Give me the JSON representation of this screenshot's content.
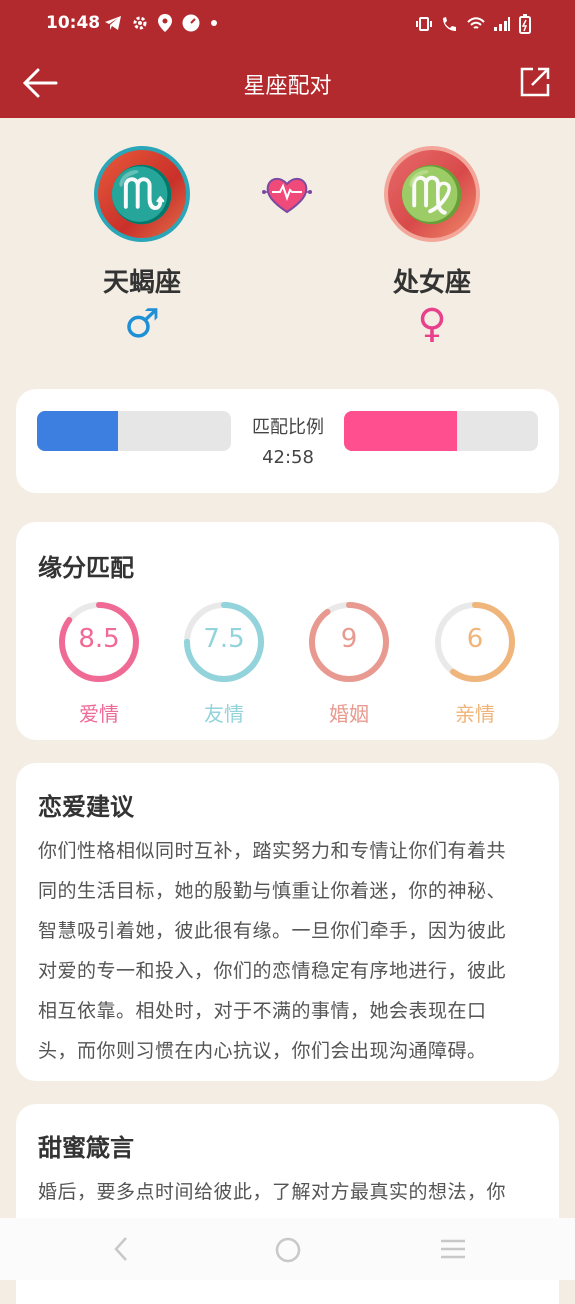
{
  "status_bar": {
    "time": "10:48"
  },
  "app_bar": {
    "title": "星座配对"
  },
  "pair": {
    "left": {
      "name": "天蝎座",
      "symbol": "♏",
      "gender_symbol": "♂",
      "gender_color": "#1f8fd6"
    },
    "right": {
      "name": "处女座",
      "symbol": "♍",
      "gender_symbol": "♀",
      "gender_color": "#e8408a"
    }
  },
  "ratio": {
    "label": "匹配比例",
    "value": "42:58",
    "male_share": 0.42,
    "female_share": 0.58,
    "male_color": "#3d7fe0",
    "female_color": "#ff4f8f"
  },
  "fate": {
    "title": "缘分匹配",
    "items": [
      {
        "value": "8.5",
        "score": 8.5,
        "label": "爱情",
        "color": "#f06a96"
      },
      {
        "value": "7.5",
        "score": 7.5,
        "label": "友情",
        "color": "#92d3dc"
      },
      {
        "value": "9",
        "score": 9,
        "label": "婚姻",
        "color": "#e89a90"
      },
      {
        "value": "6",
        "score": 6,
        "label": "亲情",
        "color": "#efb57a"
      }
    ]
  },
  "love_advice": {
    "title": "恋爱建议",
    "lines": [
      "你们性格相似同时互补，踏实努力和专情让你们有着共",
      "同的生活目标，她的殷勤与慎重让你着迷，你的神秘、",
      "智慧吸引着她，彼此很有缘。一旦你们牵手，因为彼此",
      "对爱的专一和投入，你们的恋情稳定有序地进行，彼此",
      "相互依靠。相处时，对于不满的事情，她会表现在口",
      "头，而你则习惯在内心抗议，你们会出现沟通障碍。"
    ]
  },
  "sweet_words": {
    "title": "甜蜜箴言",
    "lines": [
      "婚后，要多点时间给彼此，了解对方最真实的想法，你"
    ]
  },
  "colors": {
    "primary": "#b32a2e",
    "background": "#f3ede3"
  }
}
